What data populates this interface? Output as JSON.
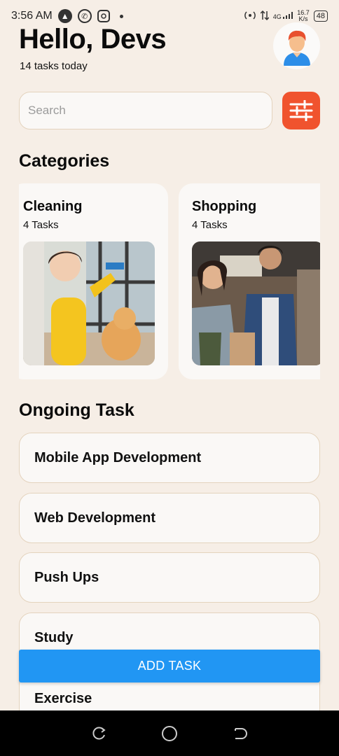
{
  "status_bar": {
    "time": "3:56 AM",
    "network_top": "4G",
    "speed": "16.7",
    "speed_unit": "K/s",
    "battery": "48"
  },
  "header": {
    "greeting": "Hello, Devs",
    "subtitle": "14 tasks today"
  },
  "search": {
    "placeholder": "Search",
    "value": ""
  },
  "filter_icon": "sliders-icon",
  "categories": {
    "title": "Categories",
    "items": [
      {
        "name": "Cleaning",
        "count": "4 Tasks",
        "image": "cleaning-photo"
      },
      {
        "name": "Shopping",
        "count": "4 Tasks",
        "image": "shopping-photo"
      }
    ]
  },
  "ongoing": {
    "title": "Ongoing Task",
    "tasks": [
      "Mobile App Development",
      "Web Development",
      "Push Ups",
      "Study",
      "Exercise"
    ]
  },
  "add_button": {
    "label": "ADD TASK"
  },
  "colors": {
    "background": "#f6eee6",
    "card": "#faf8f6",
    "card_border": "#e4d3bd",
    "filter_accent": "#f0532e",
    "add_button": "#2196f3"
  }
}
